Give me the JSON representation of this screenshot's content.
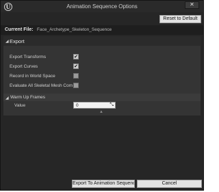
{
  "window": {
    "title": "Animation Sequence Options",
    "close_label": "✕",
    "logo_text": "U"
  },
  "toolbar": {
    "reset_label": "Reset to Default"
  },
  "current_file": {
    "label": "Current File:",
    "value": "Face_Archetype_Skeleton_Sequence"
  },
  "export": {
    "section_title": "Export",
    "options": [
      {
        "label": "Export Transforms",
        "checked": true
      },
      {
        "label": "Export Curves",
        "checked": true
      },
      {
        "label": "Record in World Space",
        "checked": false
      },
      {
        "label": "Evaluate All Skeletal Mesh Components",
        "checked": false
      }
    ],
    "warm_up": {
      "title": "Warm Up Frames",
      "value_label": "Value",
      "value": "0"
    }
  },
  "footer": {
    "export_label": "Export To Animation Sequence",
    "cancel_label": "Cancel"
  },
  "icons": {
    "expanded_triangle": "◢",
    "collapse_arrow": "▲",
    "check": "✔",
    "spin": "⤡"
  }
}
